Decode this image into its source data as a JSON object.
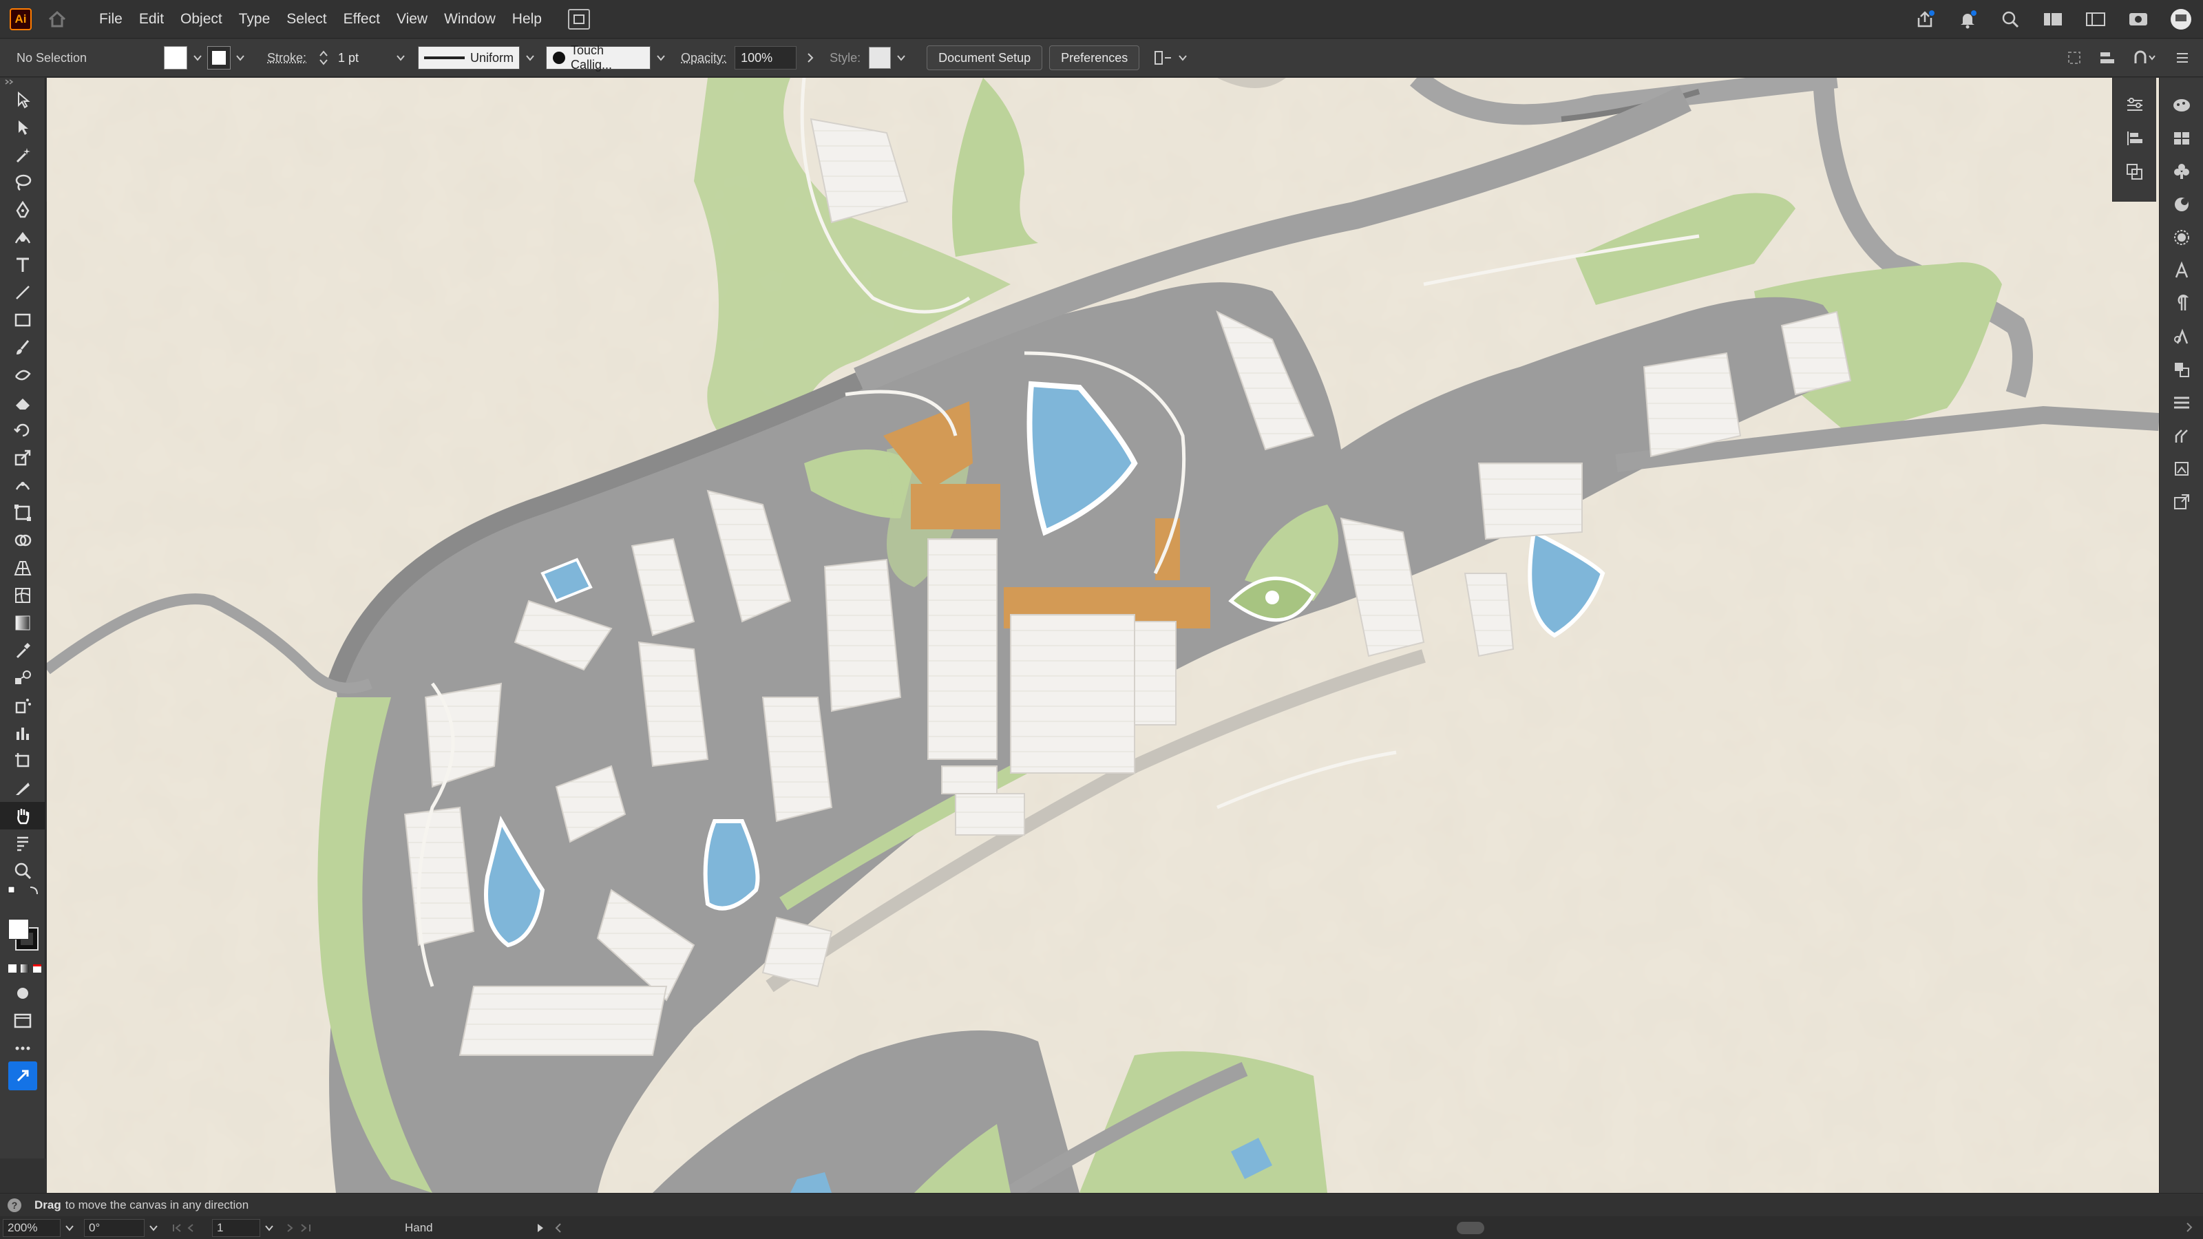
{
  "app": {
    "logo_text": "Ai"
  },
  "menu": {
    "items": [
      "File",
      "Edit",
      "Object",
      "Type",
      "Select",
      "Effect",
      "View",
      "Window",
      "Help"
    ]
  },
  "control": {
    "selection": "No Selection",
    "stroke_label": "Stroke:",
    "stroke_value": "1 pt",
    "profile": "Uniform",
    "brush": "Touch Callig...",
    "opacity_label": "Opacity:",
    "opacity_value": "100%",
    "style_label": "Style:",
    "document_setup": "Document Setup",
    "preferences": "Preferences"
  },
  "status": {
    "hint_bold": "Drag",
    "hint_rest": "to move the canvas in any direction"
  },
  "bottom": {
    "zoom": "200%",
    "rotation": "0°",
    "artboard": "1",
    "tool": "Hand"
  },
  "colors": {
    "paper": "#ede7da",
    "road": "#9a9a9a",
    "road_dark": "#7d7d7d",
    "grass": "#bcd39a",
    "water": "#7fb6d9",
    "building": "#f3f1ee",
    "amenity": "#d39a55",
    "accent": "#1473e6"
  },
  "tools": [
    "selection-tool-icon",
    "direct-selection-tool-icon",
    "magic-wand-icon",
    "lasso-icon",
    "pen-tool-icon",
    "curvature-tool-icon",
    "type-tool-icon",
    "line-tool-icon",
    "rectangle-tool-icon",
    "paintbrush-icon",
    "blob-brush-icon",
    "eraser-icon",
    "rotate-icon",
    "scale-icon",
    "warp-icon",
    "free-transform-icon",
    "shape-builder-icon",
    "perspective-grid-icon",
    "mesh-icon",
    "gradient-icon",
    "eyedropper-icon",
    "blend-icon",
    "symbol-sprayer-icon",
    "graph-icon",
    "artboard-icon",
    "slice-icon",
    "hand-tool-icon",
    "print-tiling-icon",
    "zoom-icon"
  ]
}
